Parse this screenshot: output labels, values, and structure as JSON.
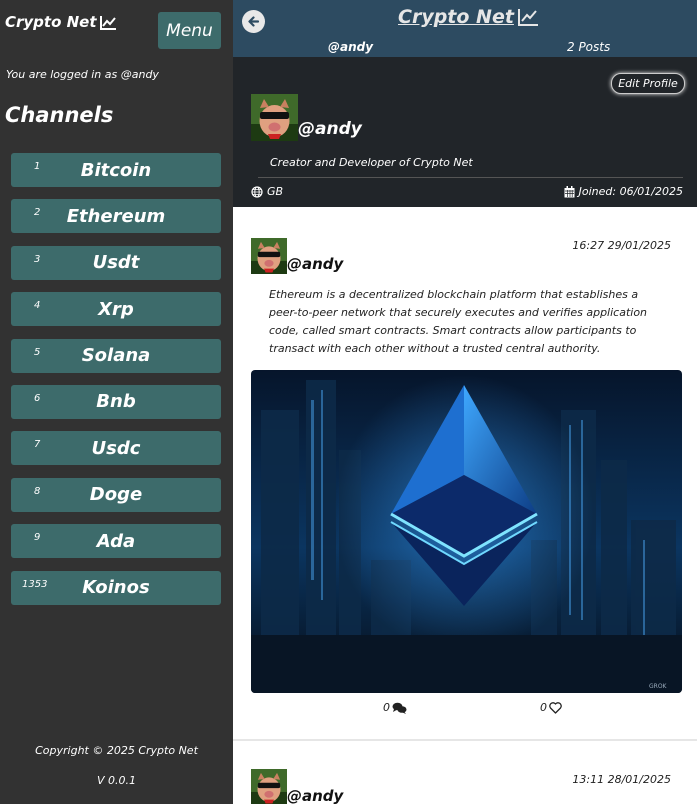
{
  "sidebar": {
    "brand": "Crypto Net",
    "menu_label": "Menu",
    "logged_in_text": "You are logged in as @andy",
    "channels_title": "Channels",
    "channels": [
      {
        "num": "1",
        "name": "Bitcoin"
      },
      {
        "num": "2",
        "name": "Ethereum"
      },
      {
        "num": "3",
        "name": "Usdt"
      },
      {
        "num": "4",
        "name": "Xrp"
      },
      {
        "num": "5",
        "name": "Solana"
      },
      {
        "num": "6",
        "name": "Bnb"
      },
      {
        "num": "7",
        "name": "Usdc"
      },
      {
        "num": "8",
        "name": "Doge"
      },
      {
        "num": "9",
        "name": "Ada"
      },
      {
        "num": "1353",
        "name": "Koinos"
      }
    ],
    "copyright": "Copyright © 2025 Crypto Net",
    "version": "V 0.0.1"
  },
  "header": {
    "title": "Crypto Net",
    "username": "@andy",
    "posts_count": "2 Posts"
  },
  "profile": {
    "edit_label": "Edit Profile",
    "username": "@andy",
    "bio": "Creator and Developer of Crypto Net",
    "country": "GB",
    "joined": "Joined: 06/01/2025"
  },
  "posts": [
    {
      "username": "@andy",
      "timestamp": "16:27 29/01/2025",
      "text": "Ethereum is a decentralized blockchain platform that establishes a peer-to-peer network that securely executes and verifies application code, called smart contracts. Smart contracts allow participants to transact with each other without a trusted central authority.",
      "comments": "0",
      "likes": "0",
      "image_watermark": "GROK"
    },
    {
      "username": "@andy",
      "timestamp": "13:11 28/01/2025"
    }
  ],
  "colors": {
    "sidebar_bg": "#323232",
    "channel_bg": "#3d6b6b",
    "topbar_bg": "#2d4b61",
    "profile_bg": "#212529"
  }
}
